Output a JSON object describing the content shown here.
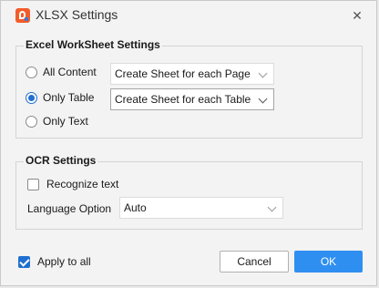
{
  "window": {
    "title": "XLSX Settings",
    "close_glyph": "✕"
  },
  "excel_group": {
    "title": "Excel WorkSheet Settings",
    "options": [
      {
        "label": "All Content",
        "checked": false,
        "dropdown_value": "Create Sheet for each Page",
        "dropdown_enabled": false
      },
      {
        "label": "Only Table",
        "checked": true,
        "dropdown_value": "Create Sheet for each Table",
        "dropdown_enabled": true
      },
      {
        "label": "Only Text",
        "checked": false
      }
    ]
  },
  "ocr_group": {
    "title": "OCR Settings",
    "recognize_label": "Recognize text",
    "recognize_checked": false,
    "language_label": "Language Option",
    "language_value": "Auto"
  },
  "footer": {
    "apply_all_label": "Apply to all",
    "apply_all_checked": true,
    "cancel_label": "Cancel",
    "ok_label": "OK"
  },
  "colors": {
    "accent": "#1f6fd0",
    "ok_button": "#2f8ff0",
    "app_icon": "#f25c2b"
  }
}
